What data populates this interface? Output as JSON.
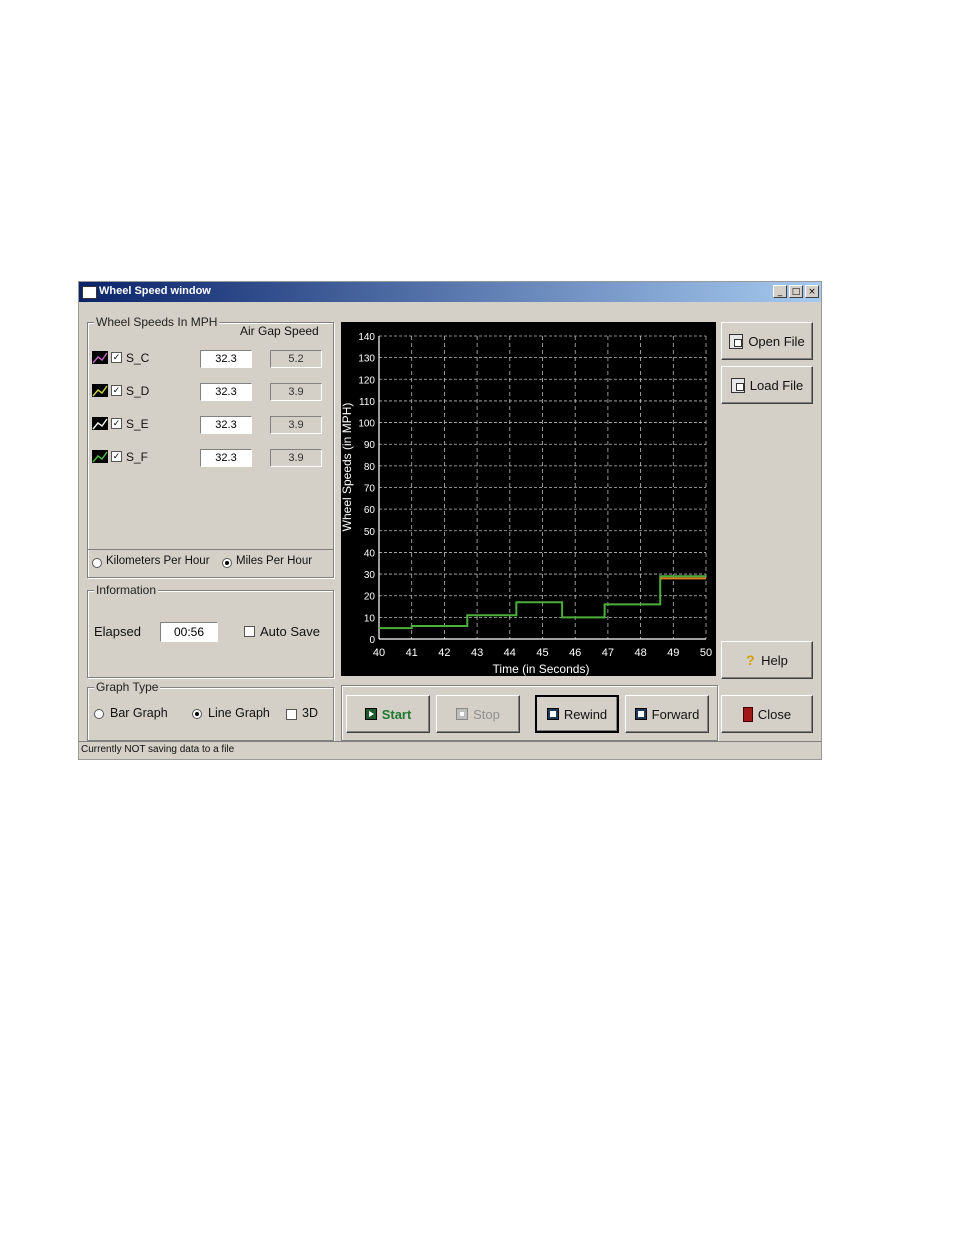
{
  "window": {
    "title": "Wheel Speed window"
  },
  "wheel_group": {
    "legend": "Wheel Speeds In MPH",
    "air_gap_header": "Air Gap Speed",
    "sensors": [
      {
        "name": "S_C",
        "speed": "32.3",
        "air_gap": "5.2",
        "checked": true,
        "swatch_color": "#c060c0"
      },
      {
        "name": "S_D",
        "speed": "32.3",
        "air_gap": "3.9",
        "checked": true,
        "swatch_color": "#d0d040"
      },
      {
        "name": "S_E",
        "speed": "32.3",
        "air_gap": "3.9",
        "checked": true,
        "swatch_color": "#f0f0f0"
      },
      {
        "name": "S_F",
        "speed": "32.3",
        "air_gap": "3.9",
        "checked": true,
        "swatch_color": "#40c040"
      }
    ],
    "unit_kmh": "Kilometers Per Hour",
    "unit_mph": "Miles Per Hour",
    "selected_unit": "mph"
  },
  "info_group": {
    "legend": "Information",
    "elapsed_label": "Elapsed",
    "elapsed_value": "00:56",
    "auto_save_label": "Auto Save",
    "auto_save_checked": false
  },
  "graph_type_group": {
    "legend": "Graph Type",
    "bar_label": "Bar Graph",
    "line_label": "Line Graph",
    "three_d_label": "3D",
    "selected": "line",
    "three_d_checked": false
  },
  "buttons": {
    "open_file": "Open File",
    "load_file": "Load File",
    "help": "Help",
    "close": "Close",
    "start": "Start",
    "stop": "Stop",
    "rewind": "Rewind",
    "forward": "Forward"
  },
  "status": "Currently NOT saving data to a file",
  "colors": {
    "title_bar": "#0a246a",
    "start_text": "#1e7a2e",
    "series_green": "#4caf3a",
    "series_yellow": "#cfd040",
    "series_orange": "#e08020"
  },
  "chart_data": {
    "type": "line",
    "xlabel": "Time (in Seconds)",
    "ylabel": "Wheel Speeds (in MPH)",
    "xlim": [
      40,
      50
    ],
    "ylim": [
      0,
      140
    ],
    "x_ticks": [
      40,
      41,
      42,
      43,
      44,
      45,
      46,
      47,
      48,
      49,
      50
    ],
    "y_ticks": [
      0,
      10,
      20,
      30,
      40,
      50,
      60,
      70,
      80,
      90,
      100,
      110,
      120,
      130,
      140
    ],
    "grid": true,
    "series": [
      {
        "color": "#4caf3a",
        "x": [
          40,
          41,
          41,
          42.7,
          42.7,
          44.2,
          44.2,
          45.6,
          45.6,
          46.9,
          46.9,
          48.6,
          48.6,
          50
        ],
        "y": [
          5,
          5,
          6,
          6,
          11,
          11,
          17,
          17,
          10,
          10,
          16,
          16,
          29,
          29
        ]
      },
      {
        "color": "#e08020",
        "x": [
          48.6,
          50
        ],
        "y": [
          28,
          28
        ]
      }
    ]
  }
}
